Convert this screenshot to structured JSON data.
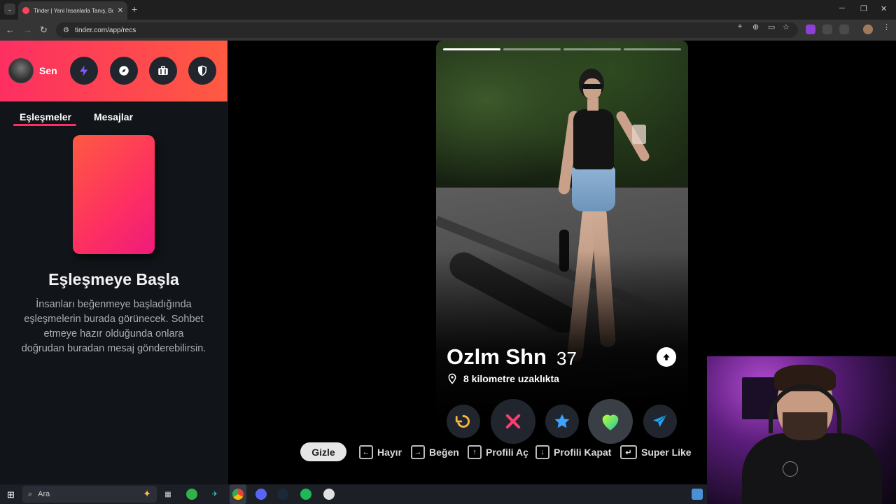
{
  "browser": {
    "tab_title": "Tinder | Yeni İnsanlarla Tanış, Bu",
    "url": "tinder.com/app/recs"
  },
  "sidebar": {
    "user_label": "Sen",
    "header_icons": [
      "lightning-icon",
      "compass-icon",
      "briefcase-icon",
      "shield-icon"
    ],
    "tabs": [
      {
        "label": "Eşleşmeler",
        "active": true
      },
      {
        "label": "Mesajlar",
        "active": false
      }
    ],
    "empty_title": "Eşleşmeye Başla",
    "empty_desc": "İnsanları beğenmeye başladığında eşleşmelerin burada görünecek. Sohbet etmeye hazır olduğunda onlara doğrudan buradan mesaj gönderebilirsin."
  },
  "profile": {
    "name": "Ozlm Shn",
    "age": "37",
    "distance": "8 kilometre uzaklıkta",
    "photo_count": 4,
    "active_photo": 1
  },
  "actions": [
    {
      "name": "rewind-button",
      "icon": "rewind-icon",
      "color": "#f5b748"
    },
    {
      "name": "nope-button",
      "icon": "x-icon",
      "color": "#fe3c72"
    },
    {
      "name": "super-like-button",
      "icon": "star-icon",
      "color": "#3ca4ff"
    },
    {
      "name": "like-button",
      "icon": "heart-icon",
      "color": "#6bd76b"
    },
    {
      "name": "boost-button",
      "icon": "send-icon",
      "color": "#1fa6f5"
    }
  ],
  "hints": {
    "hide_label": "Gizle",
    "items": [
      {
        "key": "left-arrow-key-icon",
        "label": "Hayır"
      },
      {
        "key": "right-arrow-key-icon",
        "label": "Beğen"
      },
      {
        "key": "up-arrow-key-icon",
        "label": "Profili Aç"
      },
      {
        "key": "down-arrow-key-icon",
        "label": "Profili Kapat"
      },
      {
        "key": "enter-key-icon",
        "label": "Super Like"
      }
    ]
  },
  "taskbar": {
    "search_placeholder": "Ara"
  },
  "colors": {
    "brand_gradient_start": "#fd2f62",
    "brand_gradient_end": "#fe5a41",
    "sidebar_bg": "#111418",
    "action_bg": "#21262e"
  }
}
